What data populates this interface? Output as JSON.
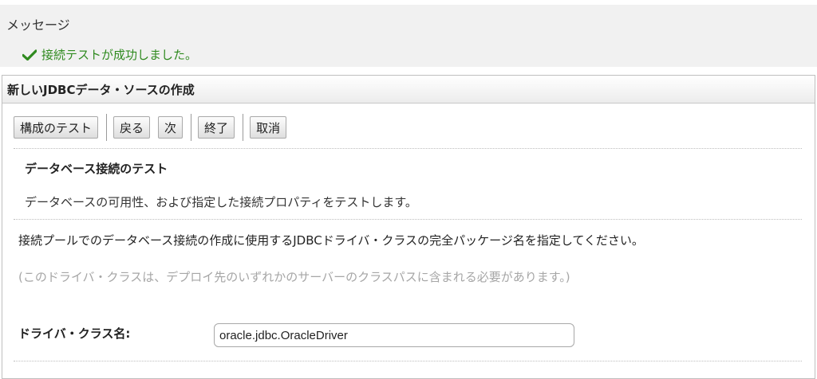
{
  "messages": {
    "title": "メッセージ",
    "success_text": "接続テストが成功しました。",
    "success_color": "#2f8a1f"
  },
  "panel": {
    "title": "新しいJDBCデータ・ソースの作成"
  },
  "toolbar": {
    "test_config_label": "構成のテスト",
    "back_label": "戻る",
    "next_label": "次",
    "finish_label": "終了",
    "cancel_label": "取消"
  },
  "section": {
    "title": "データベース接続のテスト",
    "description": "データベースの可用性、および指定した接続プロパティをテストします。"
  },
  "form": {
    "instruction": "接続プールでのデータベース接続の作成に使用するJDBCドライバ・クラスの完全パッケージ名を指定してください。",
    "note": "(このドライバ・クラスは、デプロイ先のいずれかのサーバーのクラスパスに含まれる必要があります。)",
    "driver_class_label": "ドライバ・クラス名:",
    "driver_class_value": "oracle.jdbc.OracleDriver"
  },
  "icons": {
    "success": "checkmark-icon"
  }
}
